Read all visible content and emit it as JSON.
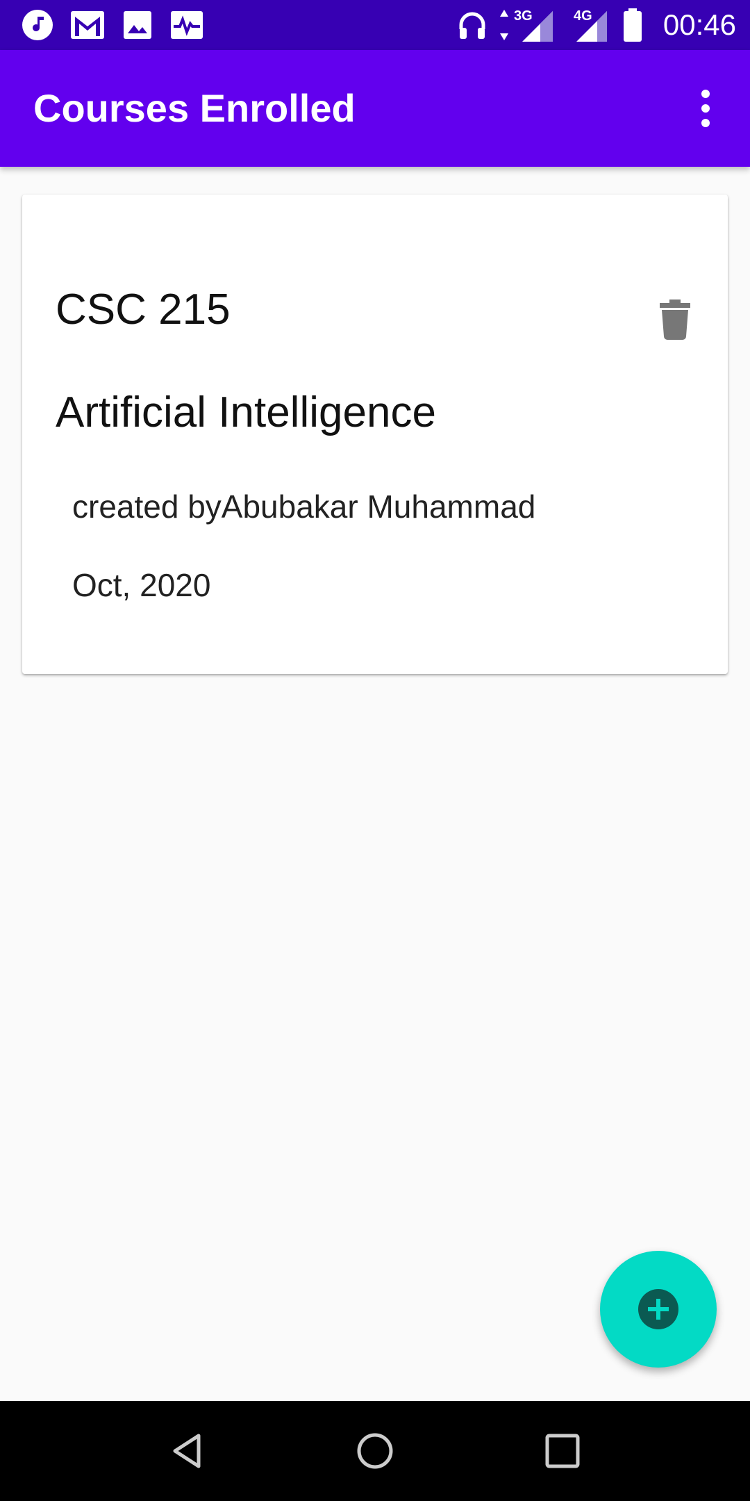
{
  "status_bar": {
    "time": "00:46",
    "network_1": "3G",
    "network_2": "4G",
    "icons": [
      "music-icon",
      "gmail-icon",
      "gallery-icon",
      "activity-icon",
      "headphones-icon",
      "signal-icon",
      "battery-icon"
    ]
  },
  "app_bar": {
    "title": "Courses Enrolled",
    "menu_icon": "more-vert-icon",
    "color": "#6200ee"
  },
  "courses": [
    {
      "code": "CSC 215",
      "name": "Artificial Intelligence",
      "created_by": "created byAbubakar Muhammad",
      "date": "Oct, 2020",
      "delete_icon": "trash-icon"
    }
  ],
  "fab": {
    "icon": "add-icon",
    "color": "#03dac5"
  },
  "nav_bar": {
    "icons": [
      "back-icon",
      "home-icon",
      "recents-icon"
    ]
  }
}
